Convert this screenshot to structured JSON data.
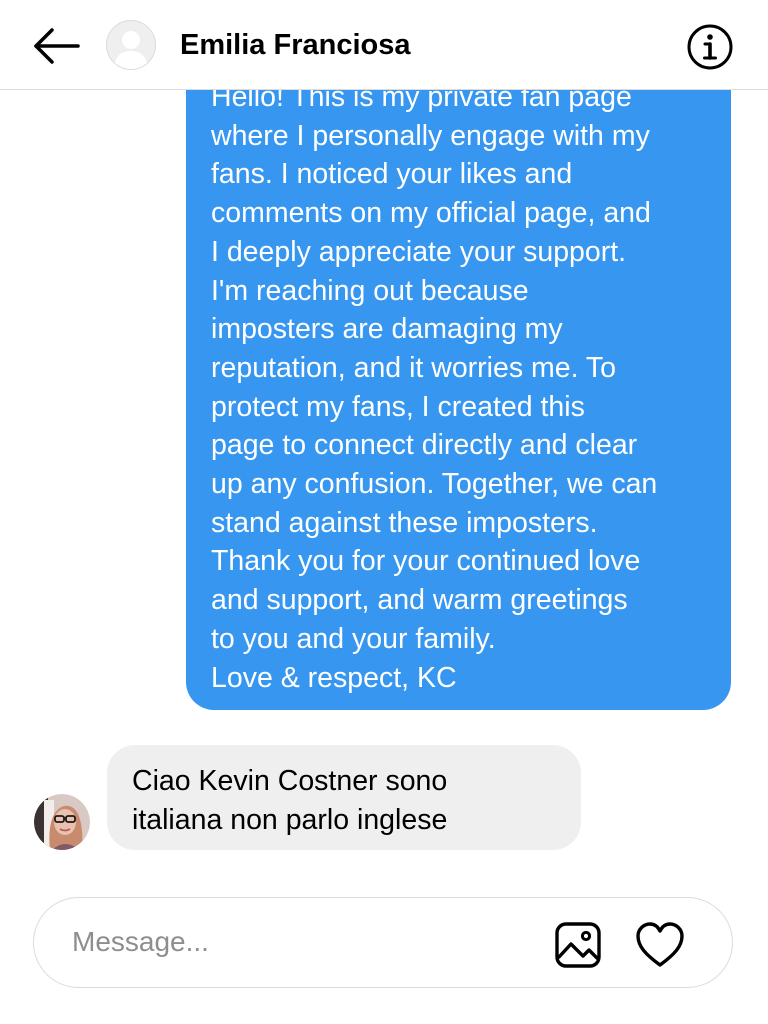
{
  "header": {
    "contact_name": "Emilia Franciosa",
    "back_icon": "arrow-left-icon",
    "info_icon": "info-circle-icon"
  },
  "thread": {
    "outgoing_message": {
      "lines": [
        "Hello! This is my private fan page",
        "where I personally engage with my",
        "fans. I noticed your likes and",
        "comments on my official page, and",
        "I deeply appreciate your support.",
        "I'm reaching out because",
        "imposters are damaging my",
        "reputation, and it worries me. To",
        "protect my fans, I created this",
        "page to connect directly and clear",
        "up any confusion. Together, we can",
        "stand against these imposters.",
        "Thank you for your continued love",
        "and support, and warm greetings",
        "to you and your family.",
        "Love & respect, KC"
      ]
    },
    "incoming_message": {
      "lines": [
        "Ciao Kevin Costner sono",
        "italiana non parlo inglese"
      ]
    }
  },
  "composer": {
    "placeholder": "Message...",
    "value": "",
    "image_icon": "image-icon",
    "like_icon": "heart-icon"
  },
  "colors": {
    "outgoing_bubble": "#3797f0",
    "incoming_bubble": "#efefef",
    "divider": "#dbdbdb",
    "placeholder": "#8e8e8e"
  }
}
